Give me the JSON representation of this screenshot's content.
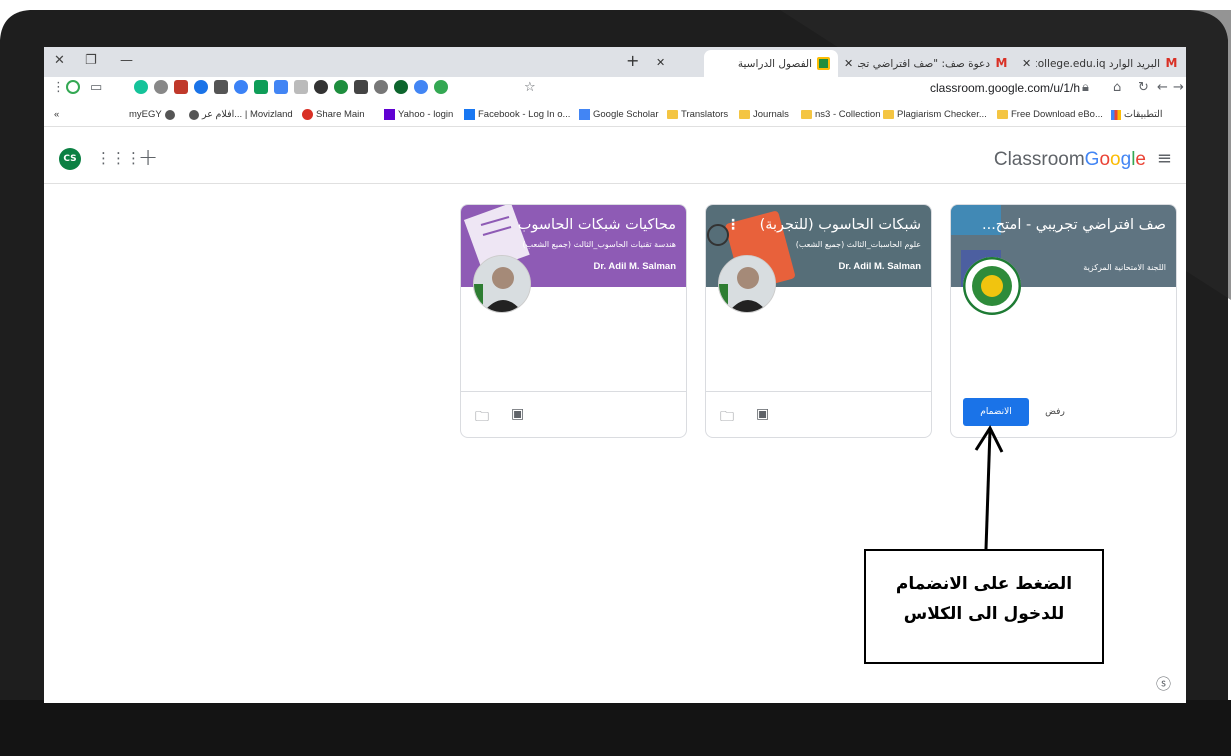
{
  "tabs": [
    {
      "title": "البريد الوارد ghdadcollege.edu.iq",
      "icon": "gmail-icon"
    },
    {
      "title": "دعوة صف: \"صف افتراضي تجريبي",
      "icon": "gmail-icon"
    },
    {
      "title": "الفصول الدراسية",
      "icon": "classroom-icon"
    }
  ],
  "address_bar": {
    "url": "classroom.google.com/u/1/h"
  },
  "bookmarks": [
    {
      "label": "التطبيقات",
      "icon": "apps-icon"
    },
    {
      "label": "Free Download eBo...",
      "icon": "folder-icon"
    },
    {
      "label": "Plagiarism Checker...",
      "icon": "folder-icon"
    },
    {
      "label": "ns3 - Collection",
      "icon": "folder-icon"
    },
    {
      "label": "Journals",
      "icon": "folder-icon"
    },
    {
      "label": "Translators",
      "icon": "folder-icon"
    },
    {
      "label": "Google Scholar",
      "icon": "scholar-icon"
    },
    {
      "label": "Facebook - Log In o...",
      "icon": "facebook-icon"
    },
    {
      "label": "Yahoo - login",
      "icon": "yahoo-icon"
    },
    {
      "label": "Share Main",
      "icon": "share-icon"
    },
    {
      "label": "افلام عر... | Movizland",
      "icon": "globe-icon"
    },
    {
      "label": "myEGY",
      "icon": "globe-icon"
    }
  ],
  "header": {
    "avatar_initials": "CS",
    "brand_google": "Google",
    "brand_classroom": "Classroom"
  },
  "cards": [
    {
      "title": "صف افتراضي تجريبي - امتح...",
      "subtitle": "اللجنة الامتحانية المركزية",
      "teacher": "",
      "color": "#5f7481",
      "join_label": "الانضمام",
      "decline_label": "رفض"
    },
    {
      "title": "شبكات الحاسوب (للتجربة)",
      "subtitle": "علوم الحاسبات_الثالث (جميع الشعب)",
      "teacher": "Dr. Adil M. Salman",
      "color": "#566e78"
    },
    {
      "title": "محاكيات شبكات الحاسوب",
      "subtitle": "هندسة تقنيات الحاسوب_الثالث (جميع الشعب)",
      "teacher": "Dr. Adil M. Salman",
      "color": "#8e5bb5"
    }
  ],
  "annotation": {
    "line1": "الضغط على الانضمام",
    "line2": "للدخول الى الكلاس"
  },
  "colors": {
    "join_button": "#1a73e8",
    "laptop_frame": "#1e1e1e"
  }
}
